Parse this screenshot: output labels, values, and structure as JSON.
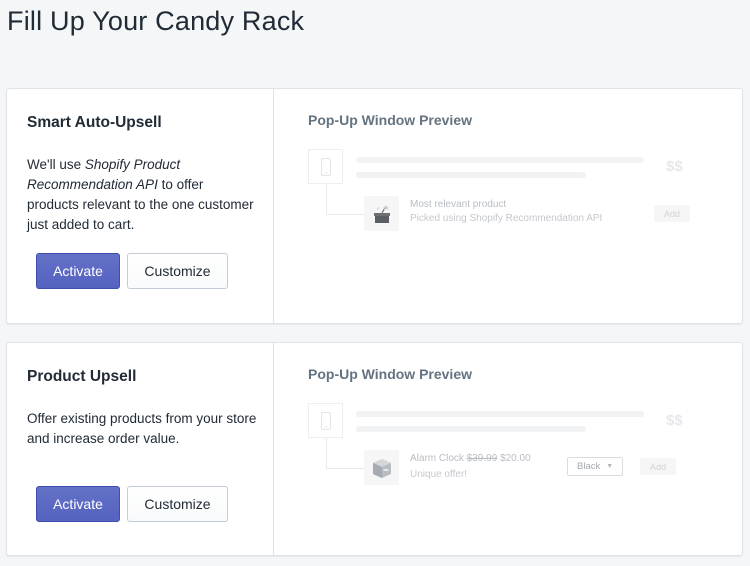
{
  "page": {
    "title": "Fill Up Your Candy Rack"
  },
  "cards": [
    {
      "title": "Smart Auto-Upsell",
      "description": {
        "prefix": "We'll use ",
        "italic": "Shopify Product Recommendation API",
        "suffix": " to offer products relevant to the one customer just added to cart."
      },
      "activate_label": "Activate",
      "customize_label": "Customize",
      "preview": {
        "title": "Pop-Up Window Preview",
        "price_symbol": "$$",
        "product_name": "Most relevant product",
        "product_sub": "Picked using Shopify Recommendation API",
        "add_label": "Add"
      }
    },
    {
      "title": "Product Upsell",
      "description": {
        "text": "Offer existing products from your store and increase order value."
      },
      "activate_label": "Activate",
      "customize_label": "Customize",
      "preview": {
        "title": "Pop-Up Window Preview",
        "price_symbol": "$$",
        "product_name": "Alarm Clock",
        "old_price": "$39.99",
        "new_price": "$20.00",
        "product_sub": "Unique offer!",
        "variant_value": "Black",
        "add_label": "Add"
      }
    }
  ],
  "colors": {
    "primary_button": "#5c6ac4",
    "background": "#f4f6f8",
    "card_border": "#dfe3e8"
  }
}
